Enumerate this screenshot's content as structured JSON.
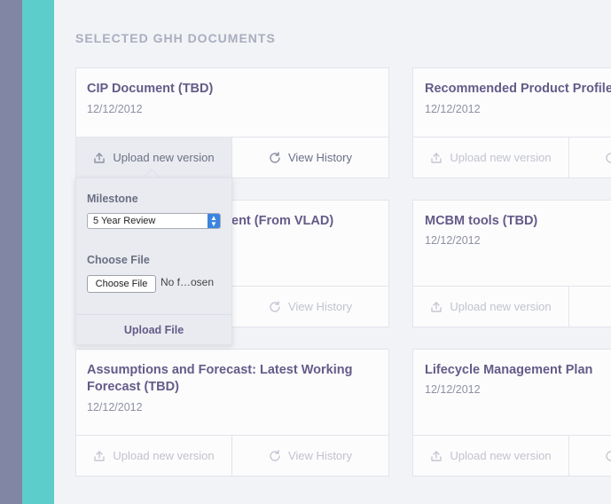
{
  "section_title": "SELECTED GHH DOCUMENTS",
  "actions": {
    "upload": "Upload new version",
    "history": "View History"
  },
  "cards": [
    {
      "title": "CIP Document (TBD)",
      "date": "12/12/2012"
    },
    {
      "title": "Recommended Product Profile",
      "date": "12/12/2012"
    },
    {
      "title": "ent (From VLAD)",
      "date": ""
    },
    {
      "title": "MCBM tools (TBD)",
      "date": "12/12/2012"
    },
    {
      "title": "Assumptions and Forecast: Latest Working Forecast (TBD)",
      "date": "12/12/2012"
    },
    {
      "title": "Lifecycle Management Plan",
      "date": "12/12/2012"
    }
  ],
  "popover": {
    "milestone_label": "Milestone",
    "milestone_value": "5 Year Review",
    "choose_file_label": "Choose File",
    "choose_file_button": "Choose File",
    "file_status": "No f…osen",
    "upload_button": "Upload File"
  },
  "colors": {
    "accent_teal": "#5ccdca",
    "rail": "#8186a5",
    "title_purple": "#655b88"
  }
}
